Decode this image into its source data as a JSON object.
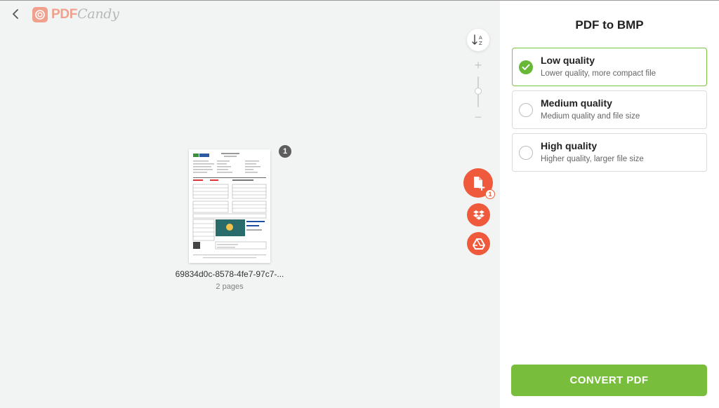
{
  "header": {
    "logo_pdf": "PDF",
    "logo_candy": "Candy"
  },
  "file": {
    "name": "69834d0c-8578-4fe7-97c7-...",
    "pages": "2 pages",
    "badge": "1"
  },
  "sidebar_tools": {
    "add_badge": "1",
    "sort_label_a": "A",
    "sort_label_z": "Z",
    "zoom_plus": "+",
    "zoom_minus": "−"
  },
  "panel": {
    "title": "PDF to BMP",
    "options": [
      {
        "title": "Low quality",
        "desc": "Lower quality, more compact file",
        "selected": true
      },
      {
        "title": "Medium quality",
        "desc": "Medium quality and file size",
        "selected": false
      },
      {
        "title": "High quality",
        "desc": "Higher quality, larger file size",
        "selected": false
      }
    ],
    "convert_label": "CONVERT PDF"
  },
  "colors": {
    "accent_green": "#78be3c",
    "brand_orange": "#f05a3c",
    "logo_pink": "#f0a18e"
  }
}
